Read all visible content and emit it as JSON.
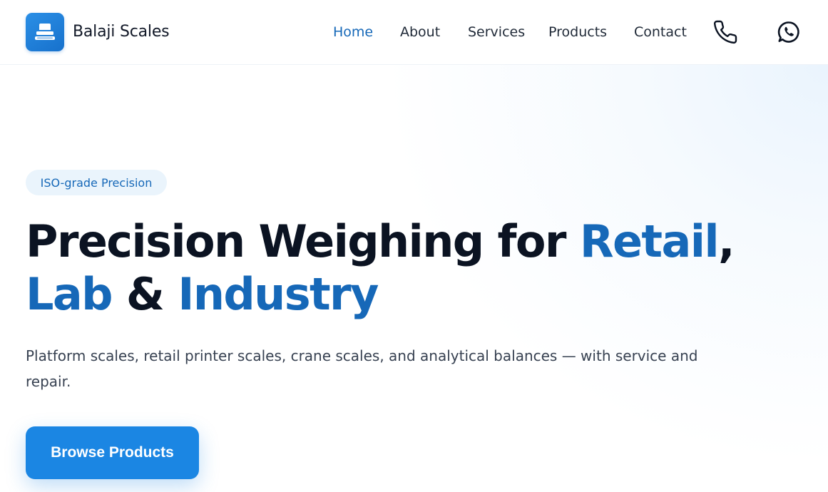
{
  "header": {
    "brand": "Balaji Scales",
    "logo_icon": "scale-icon",
    "nav": [
      {
        "label": "Home",
        "active": true
      },
      {
        "label": "About",
        "active": false
      },
      {
        "label": "Services",
        "active": false
      },
      {
        "label": "Products",
        "active": false
      },
      {
        "label": "Contact",
        "active": false
      }
    ],
    "phone_icon": "phone-icon",
    "whatsapp_icon": "whatsapp-icon"
  },
  "hero": {
    "badge": "ISO-grade Precision",
    "headline": {
      "part1": "Precision Weighing for ",
      "accent1": "Retail",
      "sep": ", ",
      "accent2": "Lab",
      "part2": " & ",
      "accent3": "Industry"
    },
    "subtext": "Platform scales, retail printer scales, crane scales, and analytical balances — with service and repair.",
    "cta": "Browse Products"
  },
  "colors": {
    "accent": "#1668b8",
    "button": "#1b86e3",
    "heading": "#0b1322",
    "badge_bg": "#eaf4fc"
  }
}
